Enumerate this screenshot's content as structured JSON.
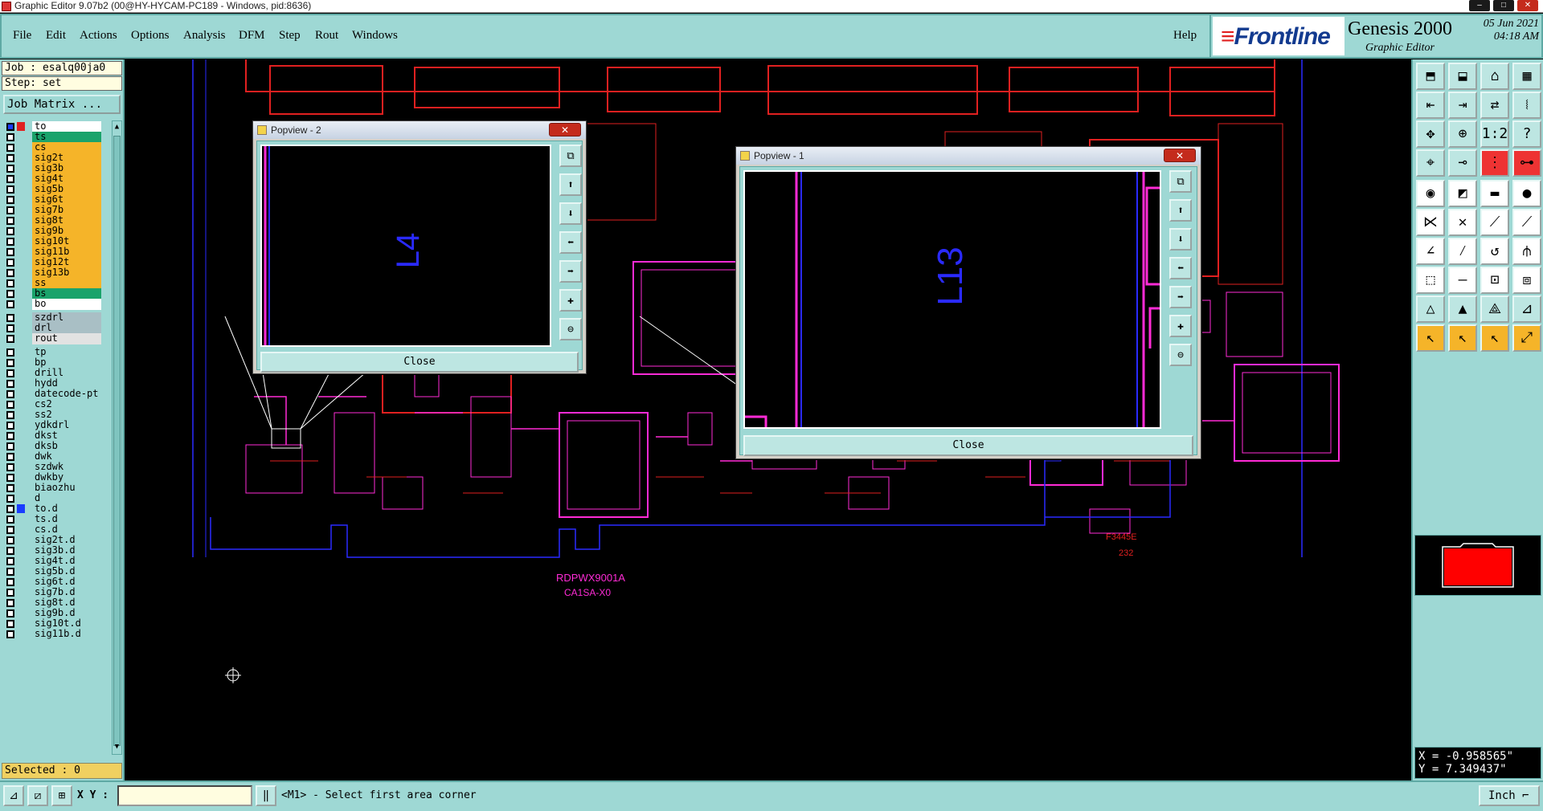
{
  "window": {
    "title": "Graphic Editor 9.07b2 (00@HY-HYCAM-PC189 - Windows, pid:8636)",
    "min_icon": "minimize-icon",
    "max_icon": "maximize-icon",
    "close_icon": "close-icon"
  },
  "menu": [
    "File",
    "Edit",
    "Actions",
    "Options",
    "Analysis",
    "DFM",
    "Step",
    "Rout",
    "Windows"
  ],
  "help": "Help",
  "brand": {
    "logo": "Frontline",
    "product": "Genesis 2000",
    "subtitle": "Graphic Editor",
    "date": "05 Jun 2021",
    "time": "04:18 AM"
  },
  "job": {
    "job_line": "Job : esalq00ja0",
    "step_line": "Step: set",
    "matrix_button": "Job Matrix ..."
  },
  "layers": [
    {
      "name": "to",
      "color": "#ffffff",
      "swatch": "#e02020"
    },
    {
      "name": "ts",
      "color": "#1aa36b",
      "swatch": ""
    },
    {
      "name": "cs",
      "color": "#f5b429",
      "swatch": ""
    },
    {
      "name": "sig2t",
      "color": "#f5b429",
      "swatch": ""
    },
    {
      "name": "sig3b",
      "color": "#f5b429",
      "swatch": ""
    },
    {
      "name": "sig4t",
      "color": "#f5b429",
      "swatch": ""
    },
    {
      "name": "sig5b",
      "color": "#f5b429",
      "swatch": ""
    },
    {
      "name": "sig6t",
      "color": "#f5b429",
      "swatch": ""
    },
    {
      "name": "sig7b",
      "color": "#f5b429",
      "swatch": ""
    },
    {
      "name": "sig8t",
      "color": "#f5b429",
      "swatch": ""
    },
    {
      "name": "sig9b",
      "color": "#f5b429",
      "swatch": ""
    },
    {
      "name": "sig10t",
      "color": "#f5b429",
      "swatch": ""
    },
    {
      "name": "sig11b",
      "color": "#f5b429",
      "swatch": ""
    },
    {
      "name": "sig12t",
      "color": "#f5b429",
      "swatch": ""
    },
    {
      "name": "sig13b",
      "color": "#f5b429",
      "swatch": ""
    },
    {
      "name": "ss",
      "color": "#f5b429",
      "swatch": ""
    },
    {
      "name": "bs",
      "color": "#1aa36b",
      "swatch": ""
    },
    {
      "name": "bo",
      "color": "#ffffff",
      "swatch": ""
    },
    {
      "name": "szdrl",
      "color": "#a9bfc5",
      "swatch": "",
      "gap": true
    },
    {
      "name": "drl",
      "color": "#a9bfc5",
      "swatch": ""
    },
    {
      "name": "rout",
      "color": "#e2e2e2",
      "swatch": ""
    },
    {
      "name": "tp",
      "color": "#9ed8d4",
      "swatch": "",
      "gap": true
    },
    {
      "name": "bp",
      "color": "#9ed8d4",
      "swatch": ""
    },
    {
      "name": "drill",
      "color": "#9ed8d4",
      "swatch": ""
    },
    {
      "name": "hydd",
      "color": "#9ed8d4",
      "swatch": ""
    },
    {
      "name": "datecode-pt",
      "color": "#9ed8d4",
      "swatch": ""
    },
    {
      "name": "cs2",
      "color": "#9ed8d4",
      "swatch": ""
    },
    {
      "name": "ss2",
      "color": "#9ed8d4",
      "swatch": ""
    },
    {
      "name": "ydkdrl",
      "color": "#9ed8d4",
      "swatch": ""
    },
    {
      "name": "dkst",
      "color": "#9ed8d4",
      "swatch": ""
    },
    {
      "name": "dksb",
      "color": "#9ed8d4",
      "swatch": ""
    },
    {
      "name": "dwk",
      "color": "#9ed8d4",
      "swatch": ""
    },
    {
      "name": "szdwk",
      "color": "#9ed8d4",
      "swatch": ""
    },
    {
      "name": "dwkby",
      "color": "#9ed8d4",
      "swatch": ""
    },
    {
      "name": "biaozhu",
      "color": "#9ed8d4",
      "swatch": ""
    },
    {
      "name": "d",
      "color": "#9ed8d4",
      "swatch": ""
    },
    {
      "name": "to.d",
      "color": "#9ed8d4",
      "swatch": "#1a3cff"
    },
    {
      "name": "ts.d",
      "color": "#9ed8d4",
      "swatch": ""
    },
    {
      "name": "cs.d",
      "color": "#9ed8d4",
      "swatch": ""
    },
    {
      "name": "sig2t.d",
      "color": "#9ed8d4",
      "swatch": ""
    },
    {
      "name": "sig3b.d",
      "color": "#9ed8d4",
      "swatch": ""
    },
    {
      "name": "sig4t.d",
      "color": "#9ed8d4",
      "swatch": ""
    },
    {
      "name": "sig5b.d",
      "color": "#9ed8d4",
      "swatch": ""
    },
    {
      "name": "sig6t.d",
      "color": "#9ed8d4",
      "swatch": ""
    },
    {
      "name": "sig7b.d",
      "color": "#9ed8d4",
      "swatch": ""
    },
    {
      "name": "sig8t.d",
      "color": "#9ed8d4",
      "swatch": ""
    },
    {
      "name": "sig9b.d",
      "color": "#9ed8d4",
      "swatch": ""
    },
    {
      "name": "sig10t.d",
      "color": "#9ed8d4",
      "swatch": ""
    },
    {
      "name": "sig11b.d",
      "color": "#9ed8d4",
      "swatch": ""
    }
  ],
  "selected": "Selected : 0",
  "board": {
    "label1": "RDPWX9001A",
    "label2": "CA1SA-X0",
    "label3": "F3445E",
    "label4": "232"
  },
  "popview2": {
    "title": "Popview - 2",
    "label": "L4",
    "close_button": "Close"
  },
  "popview1": {
    "title": "Popview - 1",
    "label": "L13",
    "close_button": "Close"
  },
  "popup_close_glyph": "✕",
  "coords": {
    "x": "X = -0.958565\"",
    "y": "Y = 7.349437\""
  },
  "status": {
    "xy_label": "X Y :",
    "xy_value": "",
    "message": "<M1> - Select first area corner",
    "units": "Inch"
  },
  "colors": {
    "panel": "#9ed8d4",
    "accent_orange": "#f5b429",
    "accent_green": "#1aa36b",
    "trace_red": "#e02020",
    "trace_magenta": "#ff2bd6",
    "outline_blue": "#2a2aff"
  }
}
